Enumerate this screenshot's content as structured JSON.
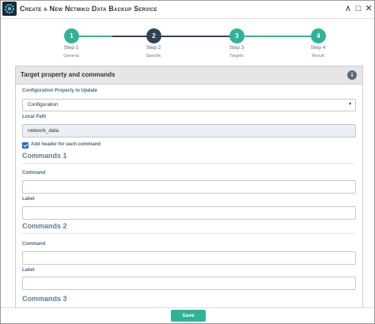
{
  "window": {
    "title": "Create a New Netmiko Data Backup Service",
    "minimize_glyph": "∧",
    "restore_glyph": "□",
    "close_glyph": "✕"
  },
  "stepper": {
    "steps": [
      {
        "number": "1",
        "title": "Step 1",
        "subtitle": "General",
        "color": "#2eb398"
      },
      {
        "number": "2",
        "title": "Step 2",
        "subtitle": "Specific",
        "color": "#2f4356"
      },
      {
        "number": "3",
        "title": "Step 3",
        "subtitle": "Targets",
        "color": "#2eb398"
      },
      {
        "number": "4",
        "title": "Step 4",
        "subtitle": "Result",
        "color": "#2eb398"
      }
    ],
    "active_step": 2
  },
  "panel": {
    "title": "Target property and commands",
    "info_glyph": "i",
    "configuration_property": {
      "label": "Configuration Property to Update",
      "value": "Configuration"
    },
    "local_path": {
      "label": "Local Path",
      "value": "network_data"
    },
    "add_header": {
      "label": "Add header for each command",
      "checked": true
    },
    "commands": [
      {
        "heading": "Commands 1",
        "command_label": "Command",
        "command_value": "",
        "label_label": "Label",
        "label_value": ""
      },
      {
        "heading": "Commands 2",
        "command_label": "Command",
        "command_value": "",
        "label_label": "Label",
        "label_value": ""
      },
      {
        "heading": "Commands 3"
      }
    ]
  },
  "footer": {
    "save_label": "Save"
  },
  "colors": {
    "accent": "#2eb398",
    "active_step": "#2f4356",
    "label": "#4a6a8a",
    "checkbox": "#2a6fd6"
  }
}
